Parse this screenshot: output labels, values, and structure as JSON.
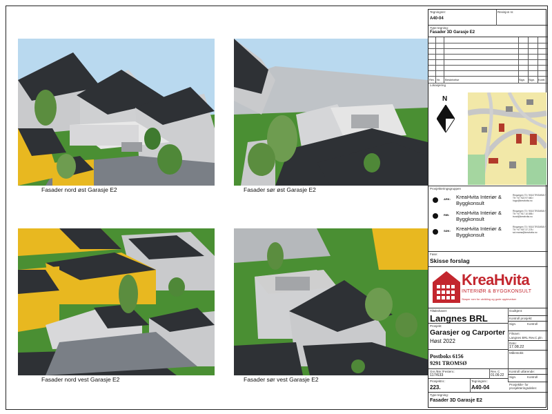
{
  "views": [
    {
      "caption": "Fasader nord øst Garasje E2"
    },
    {
      "caption": "Fasader sør øst Garasje E2"
    },
    {
      "caption": "Fasader nord vest Garasje E2"
    },
    {
      "caption": "Fasader sør vest Garasje E2"
    }
  ],
  "title_block": {
    "drawing_no_label": "Tegningsnr:",
    "drawing_no": "A40-04",
    "revision_label": "Revisjon nr.",
    "type_label": "Type tegning:",
    "type": "Fasader 3D Garasje E2",
    "rev_headers": [
      "Rev.",
      "Nr.",
      "Beskrivelse",
      "Sign.",
      "Sign.",
      "Kontr."
    ],
    "location_label": "Lokasjering",
    "north_label": "N",
    "projecting_group_label": "Prosjekteringsgruppen",
    "participants": [
      {
        "role": "ARK:",
        "name": "KreaHvita Interiør & Byggkonsult",
        "address": "Ringvegen 73 / 9018 TROMSØ / Tlf: +47 922 97 660 / hugo@kreahvita.no"
      },
      {
        "role": "RIB:",
        "name": "KreaHvita Interiør & Byggkonsult",
        "address": "Ringvegen 73 / 9018 TROMSØ / Tlf: +47 917 10 855 / trond@kreahvita.no"
      },
      {
        "role": "SØK:",
        "name": "KreaHvita Interiør & Byggkonsult",
        "address": "Ringvegen 73 / 9018 TROMSØ / Tlf: +47 907 37 278 / sol.mama@kreahvita.no"
      }
    ],
    "phase_label": "Fase:",
    "phase": "Skisse forslag",
    "logo_name": "KreaHvita",
    "logo_sub": "INTERIØR & BYGGKONSULT",
    "logo_slogan": "Skaper rom for utvikling og gode opplevelser",
    "client_label": "Tiltakshaver:",
    "client": "Langnes BRL",
    "approved_label": "Godkjent:",
    "control_label": "Kontroll prosjekt:",
    "sign_label": "Sign.",
    "kontroll_label": "Kontroll",
    "project_label": "Prosjekt:",
    "project": "Garasjer og Carporter",
    "season": "Høst 2022",
    "filename_label": "Filnavn:",
    "filename": "Langnes BRL Rev.C.pln",
    "date_label": "Dato:",
    "date": "17.08.22",
    "scale_label": "Målestokk:",
    "postbox": "Postboks 6156",
    "postcode": "9291 TROMSØ",
    "gnr_label": "Gnr./Bnr./Festenr.:",
    "gnr": "117/633",
    "revdate_label": "Rev. C",
    "revdate": "01.09.22",
    "external_control_label": "Kontroll utførende:",
    "project_no_label": "Prosjektnr.:",
    "project_no": "223.",
    "drawing_no_label2": "Tegningsnr.:",
    "drawing_no2": "A40-04",
    "proj_resp_label": "Prosjektle- for prosjekteringsdelen:",
    "type_label2": "Type tegning:",
    "type2": "Fasader 3D Garasje E2"
  },
  "colors": {
    "yellow_house": "#e8b820",
    "roof": "#2e3135",
    "grass": "#3f8a2e",
    "sky": "#b9d9ef",
    "logo_red": "#c3262e"
  }
}
